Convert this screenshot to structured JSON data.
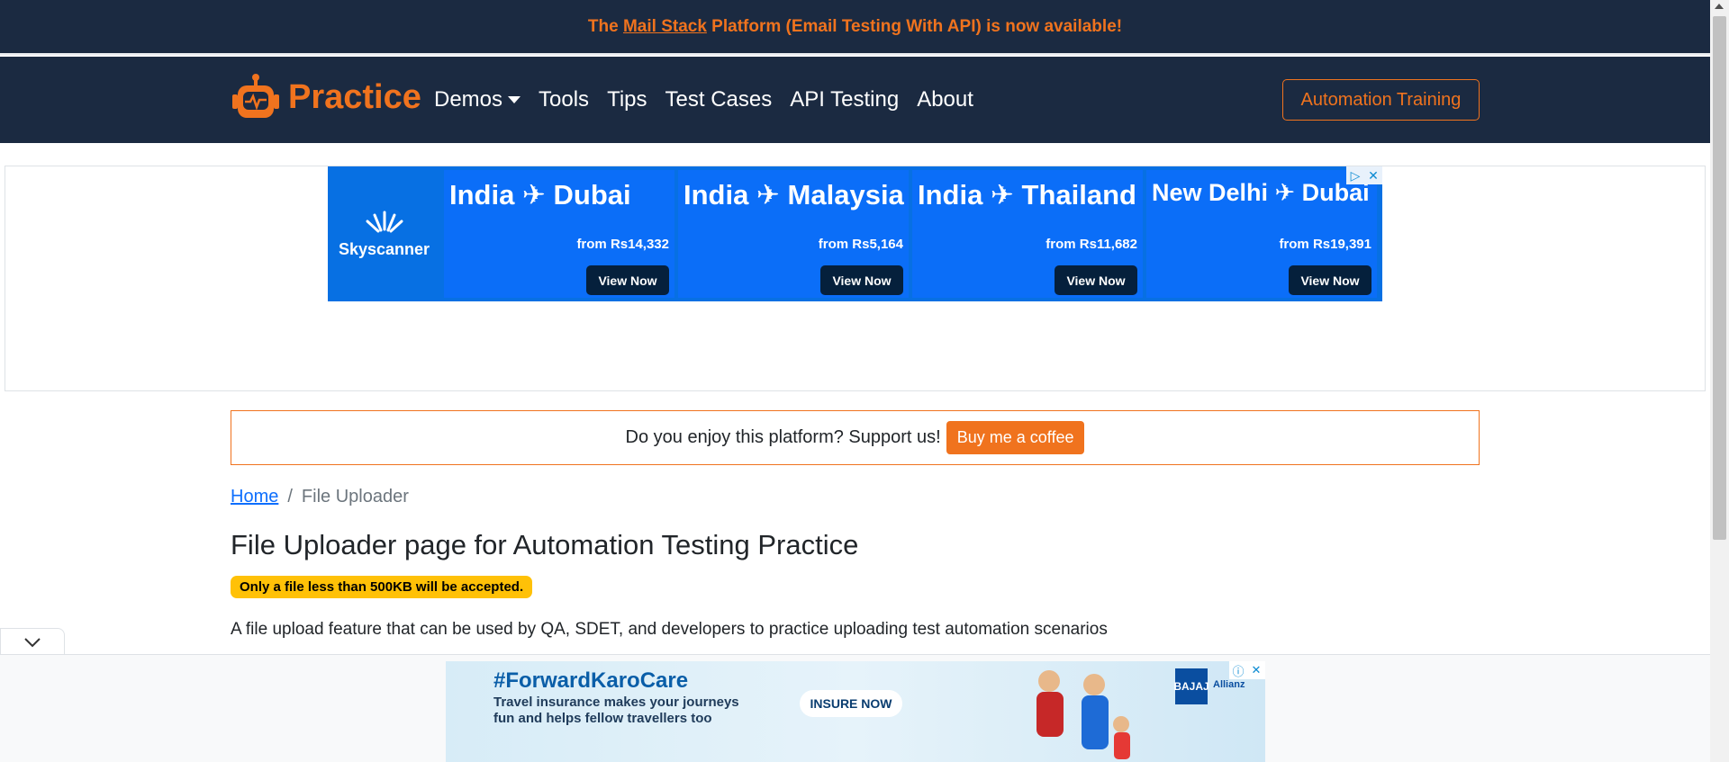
{
  "announcement": {
    "prefix": "The ",
    "link": "Mail Stack",
    "suffix": " Platform (Email Testing With API) is now available!"
  },
  "nav": {
    "brand": "Practice",
    "items": [
      {
        "label": "Demos",
        "dropdown": true
      },
      {
        "label": "Tools"
      },
      {
        "label": "Tips"
      },
      {
        "label": "Test Cases"
      },
      {
        "label": "API Testing"
      },
      {
        "label": "About"
      }
    ],
    "cta": "Automation Training"
  },
  "ad_top": {
    "logo": "Skyscanner",
    "deals": [
      {
        "route": "India ✈ Dubai",
        "price": "from Rs14,332",
        "button": "View Now"
      },
      {
        "route": "India ✈ Malaysia",
        "price": "from Rs5,164",
        "button": "View Now"
      },
      {
        "route": "India ✈ Thailand",
        "price": "from Rs11,682",
        "button": "View Now"
      },
      {
        "route": "New Delhi ✈ Dubai",
        "price": "from Rs19,391",
        "button": "View Now"
      }
    ]
  },
  "support": {
    "text": "Do you enjoy this platform? Support us!",
    "button": "Buy me a coffee"
  },
  "breadcrumb": {
    "home": "Home",
    "separator": "/",
    "current": "File Uploader"
  },
  "page": {
    "title": "File Uploader page for Automation Testing Practice",
    "badge": "Only a file less than 500KB will be accepted.",
    "description": "A file upload feature that can be used by QA, SDET, and developers to practice uploading test automation scenarios"
  },
  "ad_bottom": {
    "hashtag": "#ForwardKaroCare",
    "line1": "Travel insurance makes your journeys",
    "line2": "fun and helps fellow travellers too",
    "button": "INSURE NOW",
    "brand": "BAJAJ",
    "partner": "Allianz"
  },
  "colors": {
    "navy": "#1b2a41",
    "accent": "#f0731e",
    "skyscanner": "#0770e3",
    "badge": "#ffc107"
  }
}
